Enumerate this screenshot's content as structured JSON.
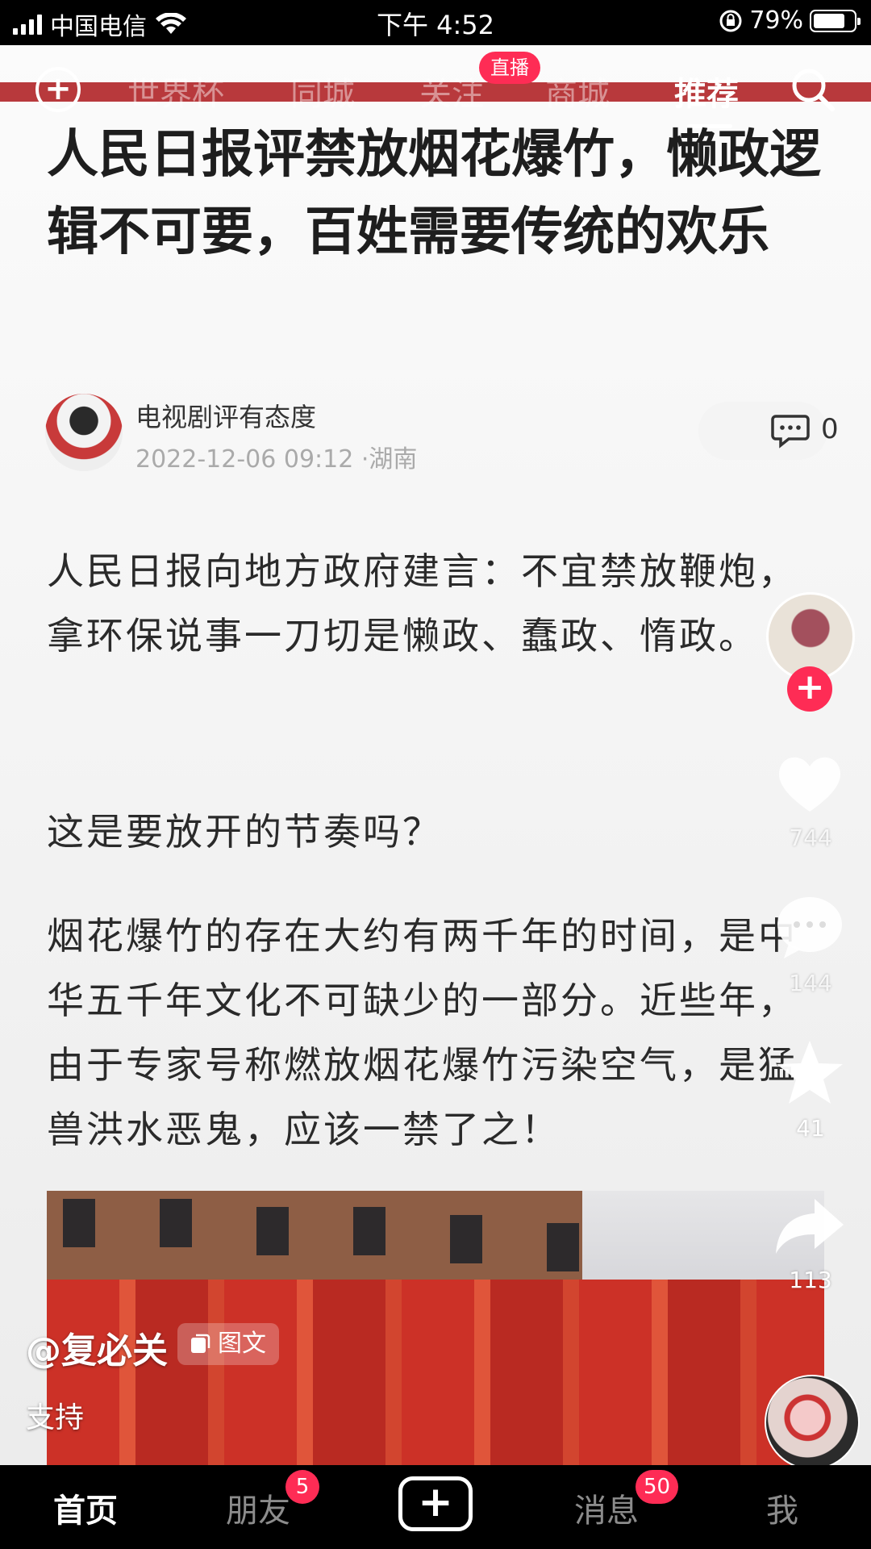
{
  "status_bar": {
    "carrier": "中国电信",
    "time": "下午 4:52",
    "battery": "79%",
    "battery_level": 0.79
  },
  "top_tabs": {
    "items": [
      "世界杯",
      "同城",
      "关注",
      "商城",
      "推荐"
    ],
    "active": "推荐",
    "live_badge": "直播"
  },
  "article": {
    "headline": "人民日报评禁放烟花爆竹，懒政逻辑不可要，百姓需要传统的欢乐",
    "author": "电视剧评有态度",
    "meta": "2022-12-06 09:12 ·湖南",
    "comment_count": "0",
    "paragraphs": [
      "人民日报向地方政府建言：不宜禁放鞭炮，拿环保说事一刀切是懒政、蠢政、惰政。",
      "这是要放开的节奏吗？",
      "烟花爆竹的存在大约有两千年的时间，是中华五千年文化不可缺少的一部分。近些年，由于专家号称燃放烟花爆竹污染空气，是猛兽洪水恶鬼，应该一禁了之！"
    ]
  },
  "right_rail": {
    "likes": "744",
    "comments": "144",
    "favorites": "41",
    "shares": "113"
  },
  "post": {
    "uploader": "@复必关",
    "type_label": "图文",
    "caption": "支持"
  },
  "bottom_nav": {
    "home": "首页",
    "friends": "朋友",
    "friends_badge": "5",
    "messages": "消息",
    "messages_badge": "50",
    "me": "我"
  },
  "colors": {
    "accent": "#fe2c55",
    "strip": "#b8393c"
  }
}
